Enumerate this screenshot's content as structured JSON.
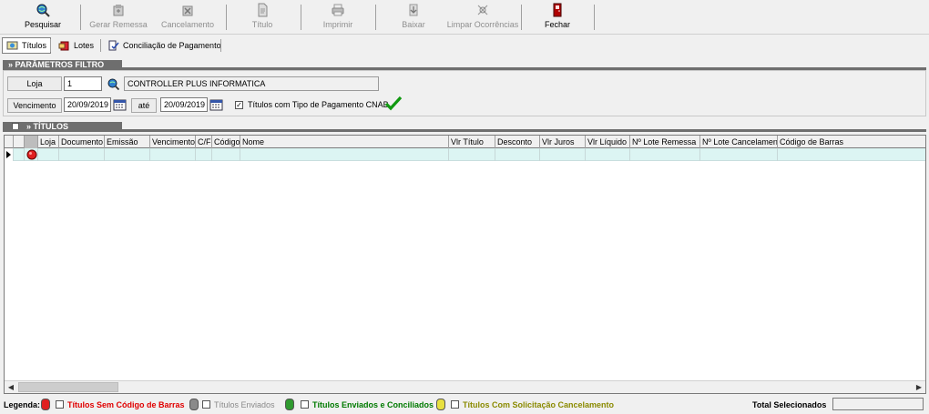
{
  "toolbar": {
    "pesquisar": "Pesquisar",
    "gerar_remessa": "Gerar Remessa",
    "cancelamento": "Cancelamento",
    "titulo": "Título",
    "imprimir": "Imprimir",
    "baixar": "Baixar",
    "limpar_ocorrencias": "Limpar Ocorrências",
    "fechar": "Fechar"
  },
  "tabs": {
    "titulos": "Títulos",
    "lotes": "Lotes",
    "conciliacao": "Conciliação de Pagamento"
  },
  "filter": {
    "section_title": "» PARÂMETROS FILTRO",
    "loja_label": "Loja",
    "loja_value": "1",
    "loja_name": "CONTROLLER PLUS INFORMATICA",
    "vencimento_label": "Vencimento",
    "date_from": "20/09/2019",
    "ate_label": "até",
    "date_to": "20/09/2019",
    "cnab_label": "Títulos com Tipo de Pagamento CNAB",
    "cnab_checked": "✓"
  },
  "grid": {
    "section_title": "» TÍTULOS",
    "columns": [
      "",
      "",
      "Loja",
      "Documento",
      "Emissão",
      "Vencimento",
      "C/F",
      "Código",
      "Nome",
      "Vlr Título",
      "Desconto",
      "Vlr Juros",
      "Vlr Líquido",
      "Nº Lote Remessa",
      "Nº Lote Cancelamento",
      "Código de Barras"
    ]
  },
  "legend": {
    "label": "Legenda:",
    "sem_codigo": "Títulos Sem Código de Barras",
    "enviados": "Títulos Enviados",
    "conciliados": "Títulos Enviados e Conciliados",
    "cancelamento": "Títulos Com Solicitação Cancelamento",
    "total_label": "Total Selecionados"
  },
  "colors": {
    "red": "#e00000",
    "gray": "#8a8a8a",
    "green": "#007a00",
    "olive": "#8a8a00",
    "row_highlight": "#dcf5f3"
  },
  "icons": [
    "search-globe-icon",
    "generate-batch-icon",
    "cancel-batch-icon",
    "document-icon",
    "printer-icon",
    "download-icon",
    "clear-icon",
    "exit-door-icon",
    "calendar-icon",
    "confirm-check-icon"
  ]
}
